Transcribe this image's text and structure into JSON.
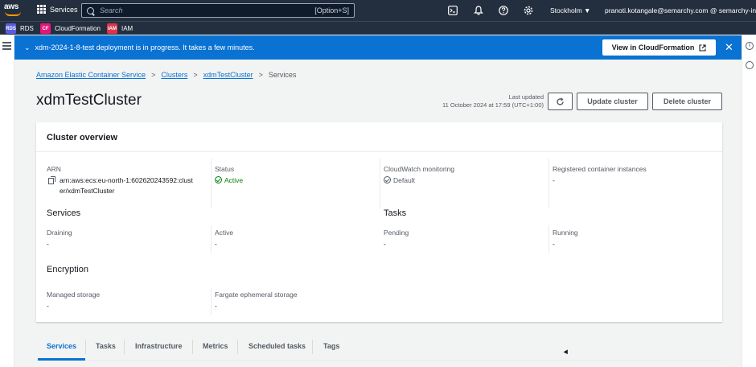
{
  "topnav": {
    "logo": "aws",
    "services_label": "Services",
    "search_placeholder": "Search",
    "search_shortcut": "[Option+S]",
    "region": "Stockholm ▼",
    "account": "pranoti.kotangale@semarchy.com @ semarchy-inc ▼",
    "icons": [
      "grid-icon",
      "search-icon",
      "cloudshell-icon",
      "bell-icon",
      "help-icon",
      "gear-icon"
    ]
  },
  "favorites": [
    {
      "label": "RDS",
      "color": "#5a5ce0",
      "abbr": "RDS"
    },
    {
      "label": "CloudFormation",
      "color": "#e7157b",
      "abbr": "CF"
    },
    {
      "label": "IAM",
      "color": "#dd344c",
      "abbr": "IAM"
    }
  ],
  "flash": {
    "message": "xdm-2024-1-8-test deployment is in progress. It takes a few minutes.",
    "button": "View in CloudFormation",
    "color": "#0972d3"
  },
  "breadcrumb": [
    "Amazon Elastic Container Service",
    "Clusters",
    "xdmTestCluster",
    "Services"
  ],
  "page": {
    "title": "xdmTestCluster",
    "last_updated_label": "Last updated",
    "last_updated_value": "11 October 2024 at 17:59 (UTC+1:00)",
    "update_button": "Update cluster",
    "delete_button": "Delete cluster"
  },
  "overview": {
    "title": "Cluster overview",
    "arn_label": "ARN",
    "arn_line1": "arn:aws:ecs:eu-north-1:602620243592:clust",
    "arn_line2": "er/xdmTestCluster",
    "status_label": "Status",
    "status_value": "Active",
    "cloudwatch_label": "CloudWatch monitoring",
    "cloudwatch_value": "Default",
    "registered_label": "Registered container instances",
    "registered_value": "-",
    "services_heading": "Services",
    "draining_label": "Draining",
    "draining_value": "-",
    "active_label": "Active",
    "active_value": "-",
    "tasks_heading": "Tasks",
    "pending_label": "Pending",
    "pending_value": "-",
    "running_label": "Running",
    "running_value": "-",
    "encryption_heading": "Encryption",
    "managed_label": "Managed storage",
    "managed_value": "-",
    "fargate_label": "Fargate ephemeral storage",
    "fargate_value": "-"
  },
  "tabs": [
    "Services",
    "Tasks",
    "Infrastructure",
    "Metrics",
    "Scheduled tasks",
    "Tags"
  ],
  "selected_tab": "Services"
}
